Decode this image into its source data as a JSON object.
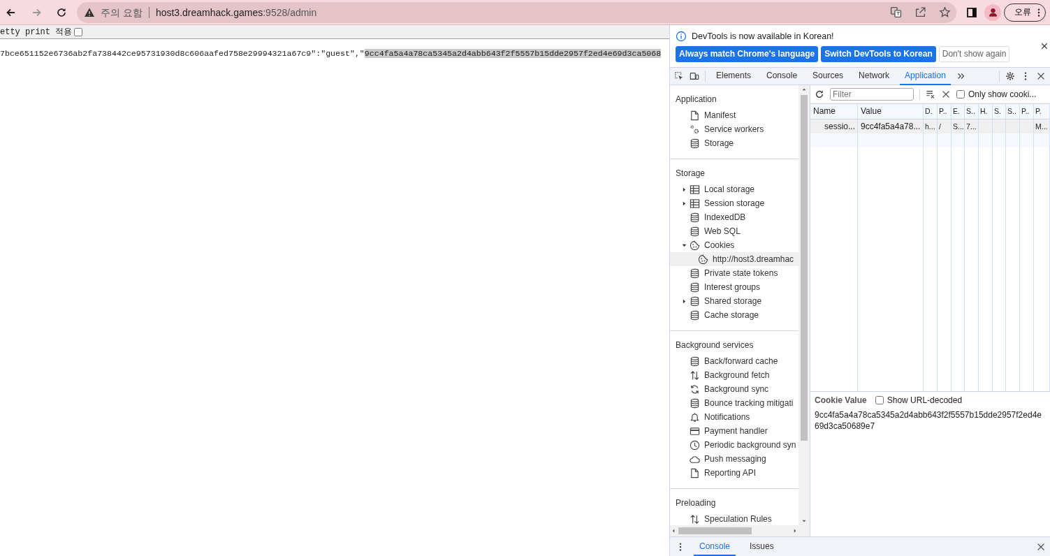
{
  "nav_buttons": [
    {
      "kind": "back",
      "disabled": false
    },
    {
      "kind": "forward",
      "disabled": true
    },
    {
      "kind": "reload",
      "disabled": false
    }
  ],
  "address_bar": {
    "security_label": "주의 요함",
    "host": "host3.dreamhack.games",
    "path": ":9528/admin"
  },
  "profile_button": {
    "label": "오류"
  },
  "page": {
    "toolbar_label": "etty print 적용",
    "pretty_print_checked": false,
    "text": "7bce651152e6736ab2fa738442ce95731930d8c606aafed758e29994321a67c9\":\"guest\",\"",
    "selected_text": "9cc4fa5a4a78ca5345a2d4abb643f2f5557b15dde2957f2ed4e69d3ca5068"
  },
  "devtools": {
    "banner": {
      "message": "DevTools is now available in Korean!",
      "buttons": [
        {
          "label": "Always match Chrome's language",
          "kind": "primary"
        },
        {
          "label": "Switch DevTools to Korean",
          "kind": "primary"
        },
        {
          "label": "Don't show again",
          "kind": "secondary"
        }
      ]
    },
    "tabs": [
      {
        "label": "Elements",
        "selected": false
      },
      {
        "label": "Console",
        "selected": false
      },
      {
        "label": "Sources",
        "selected": false
      },
      {
        "label": "Network",
        "selected": false
      },
      {
        "label": "Application",
        "selected": true
      }
    ],
    "sidebar": {
      "sections": [
        {
          "title": "Application",
          "items": [
            {
              "label": "Manifest",
              "kind": "file"
            },
            {
              "label": "Service workers",
              "kind": "gears"
            },
            {
              "label": "Storage",
              "kind": "database"
            }
          ]
        },
        {
          "title": "Storage",
          "items": [
            {
              "label": "Local storage",
              "kind": "table",
              "expanded": false
            },
            {
              "label": "Session storage",
              "kind": "table",
              "expanded": false
            },
            {
              "label": "IndexedDB",
              "kind": "database"
            },
            {
              "label": "Web SQL",
              "kind": "database"
            },
            {
              "label": "Cookies",
              "kind": "cookie",
              "expanded": true,
              "children": [
                {
                  "label": "http://host3.dreamhac",
                  "kind": "cookie",
                  "selected": true
                }
              ]
            },
            {
              "label": "Private state tokens",
              "kind": "database"
            },
            {
              "label": "Interest groups",
              "kind": "database"
            },
            {
              "label": "Shared storage",
              "kind": "database",
              "expanded": false
            },
            {
              "label": "Cache storage",
              "kind": "database"
            }
          ]
        },
        {
          "title": "Background services",
          "items": [
            {
              "label": "Back/forward cache",
              "kind": "database"
            },
            {
              "label": "Background fetch",
              "kind": "arrows"
            },
            {
              "label": "Background sync",
              "kind": "sync"
            },
            {
              "label": "Bounce tracking mitigati",
              "kind": "database"
            },
            {
              "label": "Notifications",
              "kind": "bell"
            },
            {
              "label": "Payment handler",
              "kind": "card"
            },
            {
              "label": "Periodic background syn",
              "kind": "clock"
            },
            {
              "label": "Push messaging",
              "kind": "cloud"
            },
            {
              "label": "Reporting API",
              "kind": "file"
            }
          ]
        },
        {
          "title": "Preloading",
          "items": [
            {
              "label": "Speculation Rules",
              "kind": "arrows"
            }
          ]
        }
      ]
    },
    "cookies_toolbar": {
      "filter_placeholder": "Filter",
      "only_show_label": "Only show cooki...",
      "only_show_checked": false
    },
    "table": {
      "columns": [
        "Name",
        "Value",
        "D.",
        "P..",
        "E.",
        "S..",
        "H.",
        "S.",
        "S..",
        "P..",
        "P."
      ],
      "rows": [
        {
          "selected": true,
          "cells": [
            "sessio...",
            "9cc4fa5a4a78...",
            "h...",
            "/",
            "S...",
            "7...",
            null,
            null,
            null,
            null,
            "M..."
          ]
        }
      ]
    },
    "cookie_value": {
      "title": "Cookie Value",
      "decode_label": "Show URL-decoded",
      "decode_checked": false,
      "value": "9cc4fa5a4a78ca5345a2d4abb643f2f5557b15dde2957f2ed4e69d3ca50689e7"
    },
    "drawer": {
      "tabs": [
        {
          "label": "Console",
          "selected": true
        },
        {
          "label": "Issues",
          "selected": false
        }
      ]
    }
  }
}
